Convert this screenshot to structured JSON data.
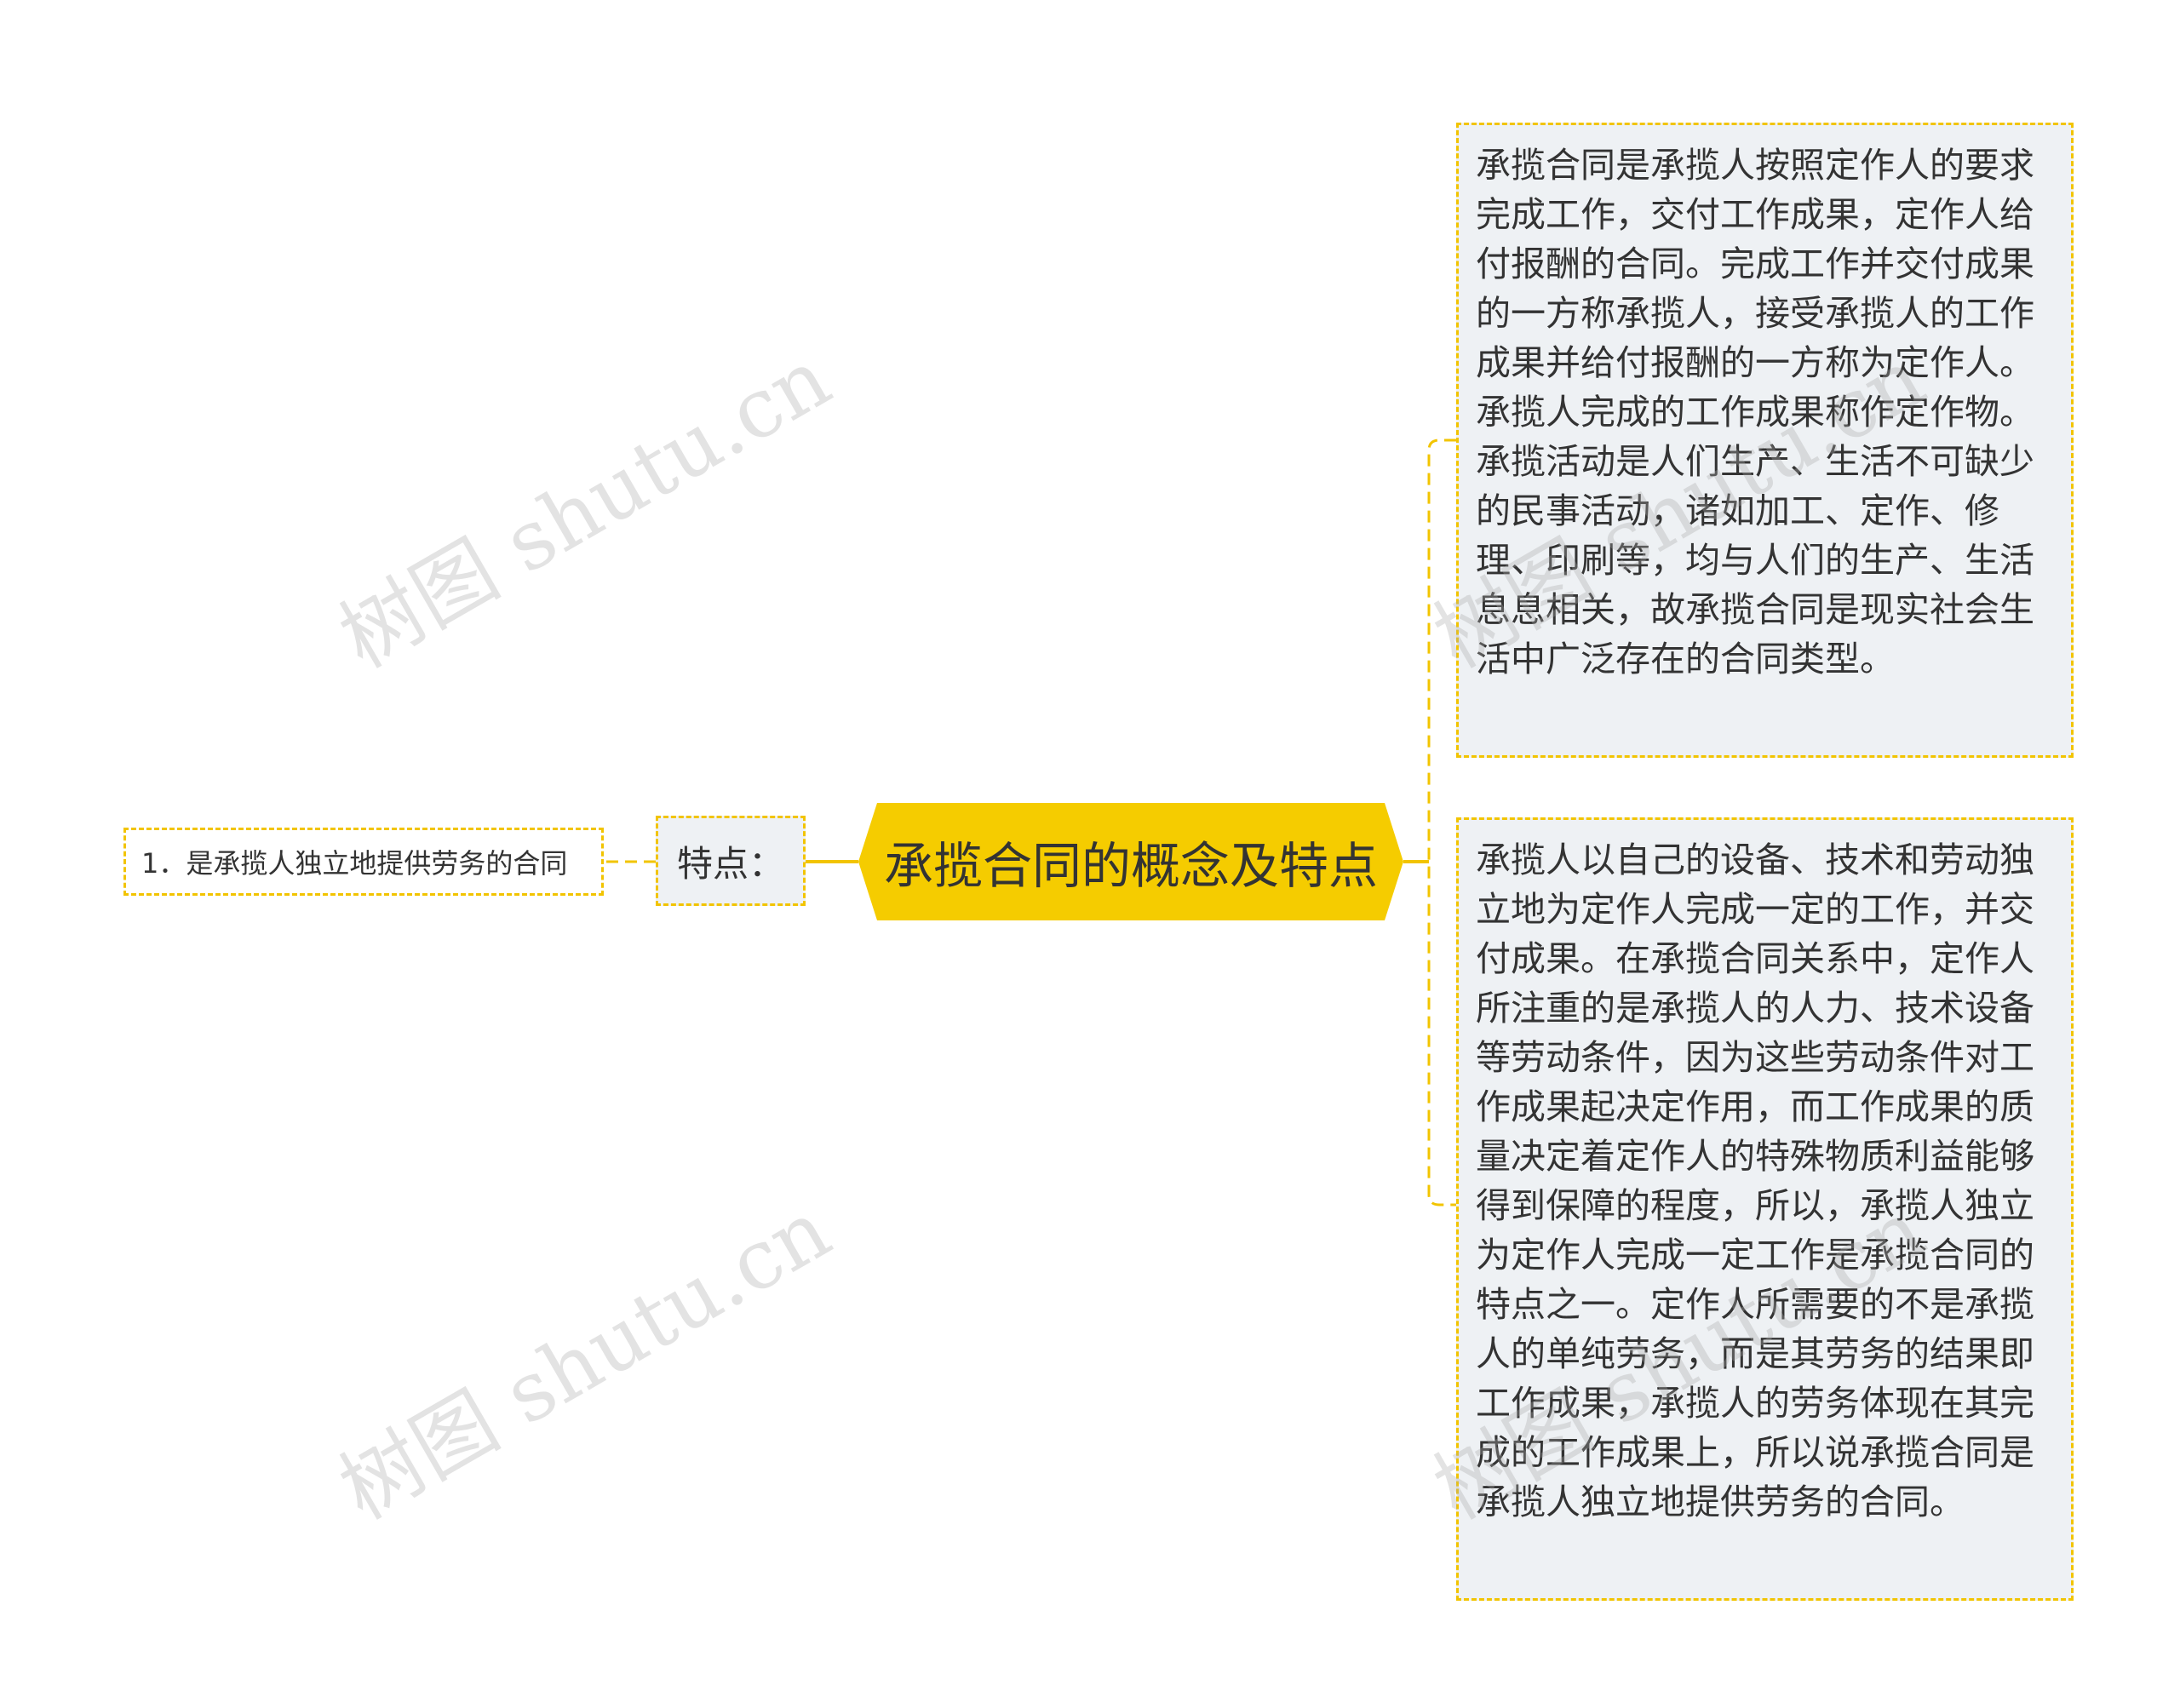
{
  "center": {
    "label": "承揽合同的概念及特点"
  },
  "feature": {
    "label": "特点："
  },
  "leaf": {
    "label": "1．是承揽人独立地提供劳务的合同"
  },
  "descriptions": [
    {
      "text": "承揽合同是承揽人按照定作人的要求完成工作，交付工作成果，定作人给付报酬的合同。完成工作并交付成果的一方称承揽人，接受承揽人的工作成果并给付报酬的一方称为定作人。承揽人完成的工作成果称作定作物。承揽活动是人们生产、生活不可缺少的民事活动，诸如加工、定作、修理、印刷等，均与人们的生产、生活息息相关，故承揽合同是现实社会生活中广泛存在的合同类型。"
    },
    {
      "text": "承揽人以自己的设备、技术和劳动独立地为定作人完成一定的工作，并交付成果。在承揽合同关系中，定作人所注重的是承揽人的人力、技术设备等劳动条件，因为这些劳动条件对工作成果起决定作用，而工作成果的质量决定着定作人的特殊物质利益能够得到保障的程度，所以，承揽人独立为定作人完成一定工作是承揽合同的特点之一。定作人所需要的不是承揽人的单纯劳务，而是其劳务的结果即工作成果，承揽人的劳务体现在其完成的工作成果上，所以说承揽合同是承揽人独立地提供劳务的合同。"
    }
  ],
  "watermarks": [
    "树图 shutu.cn",
    "树图 shutu.cn",
    "树图 shutu.cn",
    "树图 shutu.cn"
  ],
  "colors": {
    "accent": "#f5cc00",
    "connector": "#f2c400",
    "node_fill": "#eef1f4",
    "text": "#333333"
  }
}
